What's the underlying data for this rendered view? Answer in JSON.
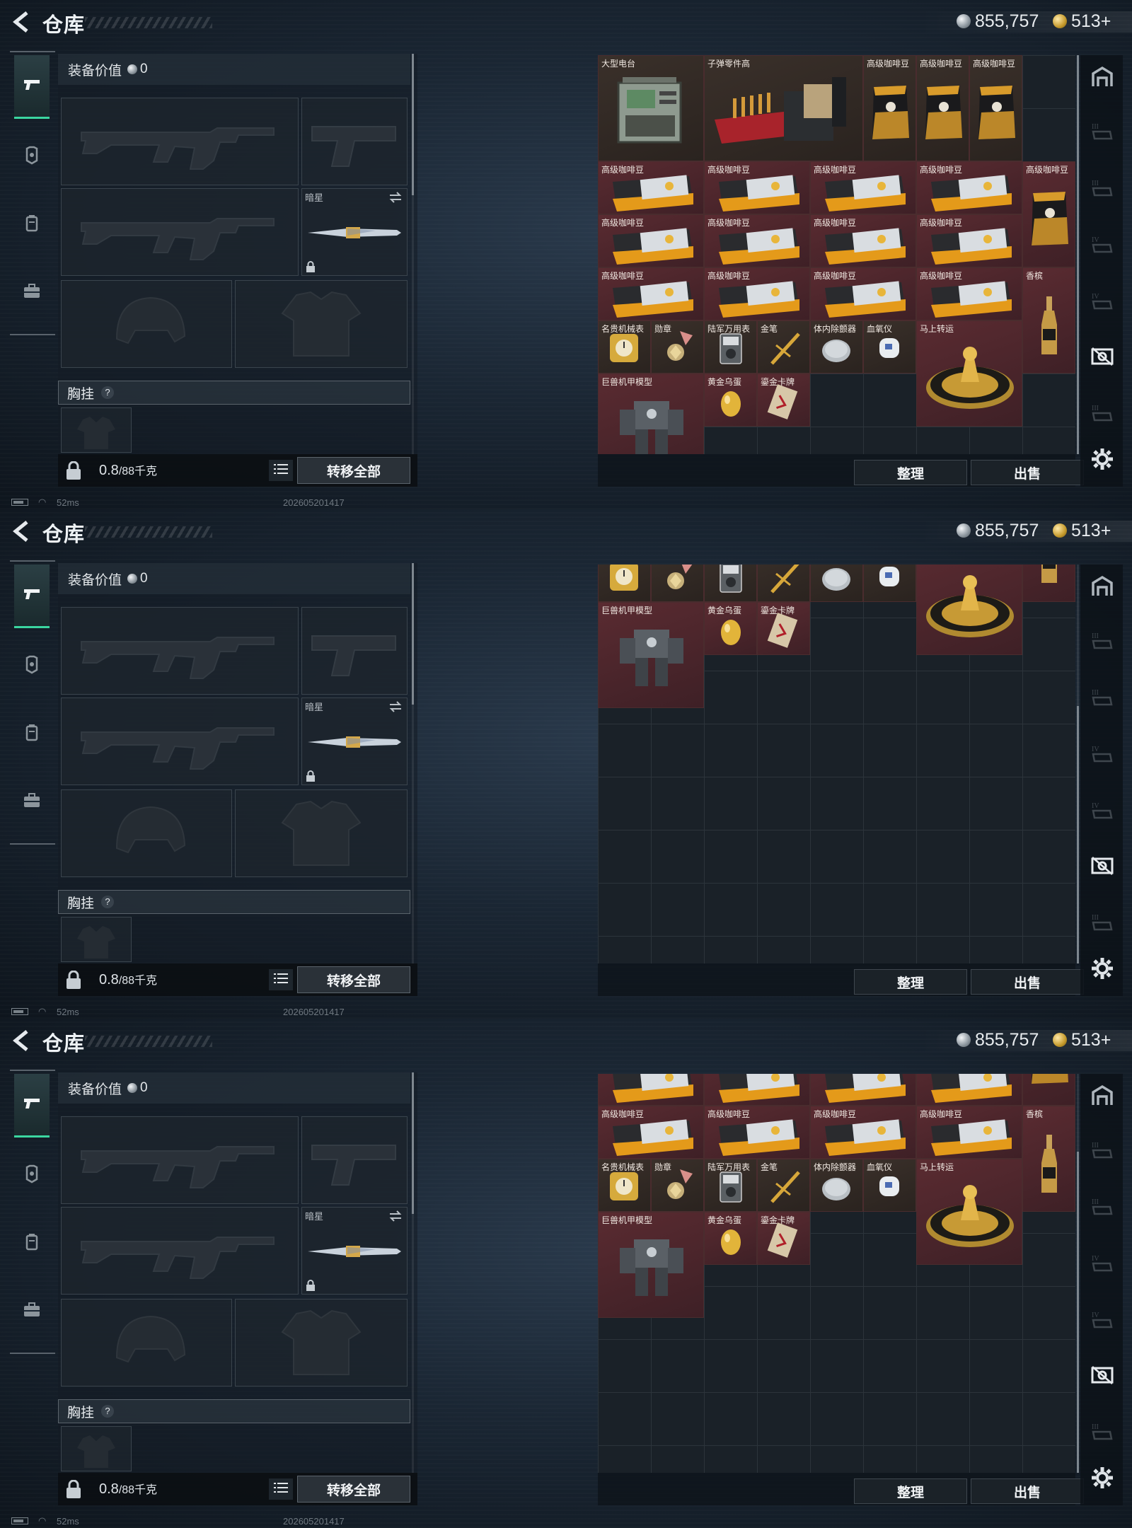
{
  "header": {
    "title": "仓库",
    "silver": "855,757",
    "gold": "513+"
  },
  "equipment": {
    "value_label": "装备价值",
    "value": "0",
    "secondary_weapon_name": "暗星",
    "chest_label": "胸挂",
    "chest_hint": "?",
    "weight": "0.8",
    "weight_max": "/88千克",
    "transfer_all": "转移全部"
  },
  "inventory": {
    "sort_label": "整理",
    "sell_label": "出售"
  },
  "items": {
    "radio": "大型电台",
    "ammo_parts": "子弹零件高",
    "coffee": "高级咖啡豆",
    "champagne": "香槟",
    "watch": "名贵机械表",
    "medal": "勋章",
    "army_watch": "陆军万用表",
    "gold_pen": "金笔",
    "detector": "体内除颤器",
    "oximeter": "血氧仪",
    "fortune_wheel": "马上转运",
    "mech_model": "巨兽机甲模型",
    "golden_egg": "黄金乌蛋",
    "gold_card": "鎏金卡牌"
  },
  "status": {
    "ping": "52ms",
    "stamp": "202605201417"
  },
  "colors": {
    "accent": "#3bd6a0",
    "item_red": "#5a2b31",
    "item_brown": "#3a302a"
  }
}
